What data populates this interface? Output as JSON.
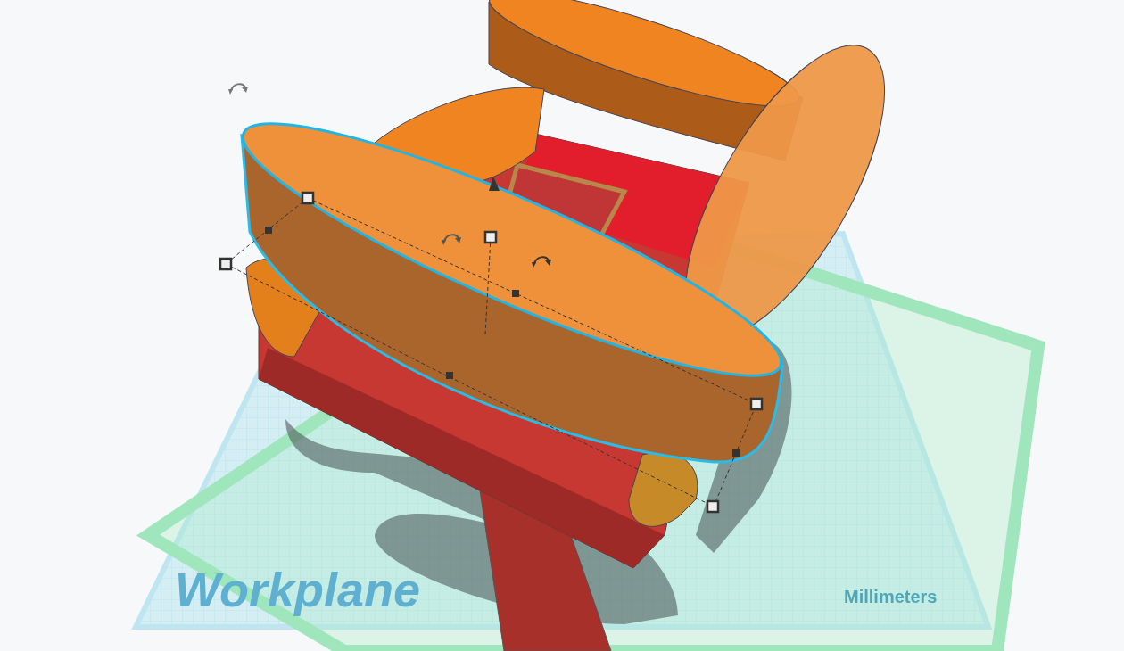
{
  "workplane": {
    "label": "Workplane",
    "units": "Millimeters"
  }
}
